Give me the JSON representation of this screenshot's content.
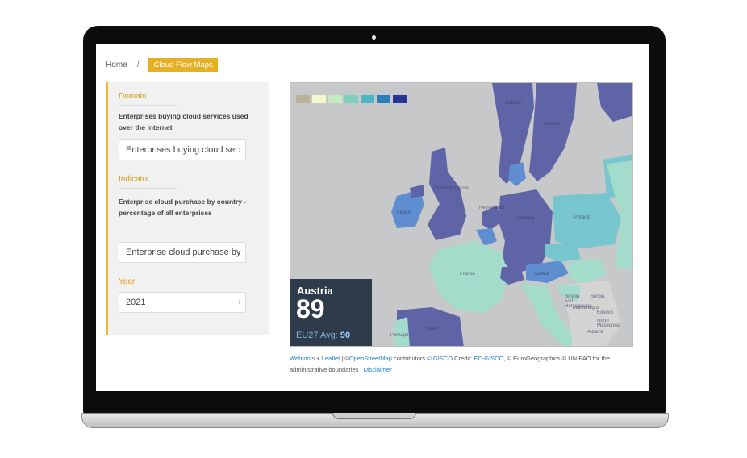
{
  "breadcrumb": {
    "home": "Home",
    "separator": "/",
    "current": "Cloud Flow Maps"
  },
  "sidebar": {
    "domain": {
      "label": "Domain",
      "description": "Enterprises buying cloud services used over the internet",
      "select_value": "Enterprises buying cloud ser"
    },
    "indicator": {
      "label": "Indicator",
      "description": "Enterprise cloud purchase by country - percentage of all enterprises",
      "select_value": "Enterprise cloud purchase by"
    },
    "year": {
      "label": "Year",
      "select_value": "2021"
    }
  },
  "map": {
    "legend_colors": [
      "#bab39c",
      "#f3f7cb",
      "#c6ebc3",
      "#82cebd",
      "#4db6c6",
      "#2c7fb8",
      "#253494"
    ],
    "country_colors": {
      "dark": "#5f64a6",
      "mid_blue": "#5f8ed0",
      "teal": "#78c6cd",
      "light_green": "#a4dccc",
      "sea": "#c6c8c9",
      "land_other": "#d4d4d4"
    },
    "labels": [
      "Norway",
      "Sweden",
      "United Kingdom",
      "Ireland",
      "Netherlands",
      "Germany",
      "Poland",
      "France",
      "Spain",
      "Portugal",
      "Austria",
      "Serbia",
      "Bosnia and Herzegovina",
      "Montenegro",
      "Kosovo",
      "North Macedonia",
      "Albania"
    ],
    "info": {
      "country": "Austria",
      "value": "89",
      "avg_prefix": "EU27 Avg:",
      "avg_value": "90"
    }
  },
  "attribution": {
    "webtools": "Webtools",
    "plus": "+",
    "leaflet": "Leaflet",
    "sep1": "|",
    "copy1": "©",
    "osm": "OpenStreetMap",
    "contributors": "contributors",
    "gisco": "© GISCO",
    "credit": "Credit:",
    "ecgisco": "EC-GISCO",
    "rest": ", © EuroGeographics © UN-FAO for the administrative boundaries |",
    "disclaimer": "Disclaimer"
  }
}
